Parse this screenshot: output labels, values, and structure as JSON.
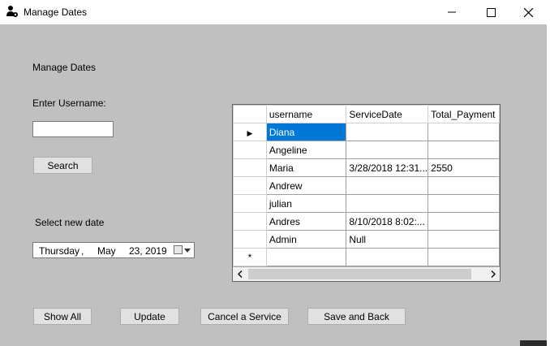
{
  "window": {
    "title": "Manage Dates",
    "minimize_icon": "minimize-icon",
    "maximize_icon": "maximize-icon",
    "close_icon": "close-icon"
  },
  "form": {
    "heading": "Manage Dates",
    "username_label": "Enter Username:",
    "username_value": "",
    "search_button": "Search",
    "date_label": "Select new date",
    "date_picker": {
      "weekday": "Thursday",
      "separator": ",",
      "month": "May",
      "day_year": "23, 2019",
      "icon": "calendar-icon"
    }
  },
  "grid": {
    "columns": [
      "username",
      "ServiceDate",
      "Total_Payment"
    ],
    "rows": [
      {
        "username": "Diana",
        "ServiceDate": "",
        "Total_Payment": "",
        "selected": true
      },
      {
        "username": "Angeline",
        "ServiceDate": "",
        "Total_Payment": ""
      },
      {
        "username": "Maria",
        "ServiceDate": "3/28/2018 12:31...",
        "Total_Payment": "2550"
      },
      {
        "username": "Andrew",
        "ServiceDate": "",
        "Total_Payment": ""
      },
      {
        "username": "julian",
        "ServiceDate": "",
        "Total_Payment": ""
      },
      {
        "username": "Andres",
        "ServiceDate": "8/10/2018 8:02:...",
        "Total_Payment": ""
      },
      {
        "username": "Admin",
        "ServiceDate": "Null",
        "Total_Payment": ""
      }
    ],
    "new_row_marker": "*",
    "current_row_marker": "▶"
  },
  "buttons": {
    "show_all": "Show All",
    "update": "Update",
    "cancel_service": "Cancel a Service",
    "save_back": "Save and Back"
  },
  "colors": {
    "form_background": "#c0c0c0",
    "selection": "#0078d7",
    "button_face": "#e1e1e1"
  }
}
